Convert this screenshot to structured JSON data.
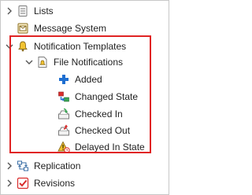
{
  "tree": {
    "lists": {
      "label": "Lists"
    },
    "message_system": {
      "label": "Message System"
    },
    "notification_templates": {
      "label": "Notification Templates",
      "file_notifications": {
        "label": "File Notifications",
        "items": [
          {
            "label": "Added"
          },
          {
            "label": "Changed State"
          },
          {
            "label": "Checked In"
          },
          {
            "label": "Checked Out"
          },
          {
            "label": "Delayed In State"
          }
        ]
      }
    },
    "replication": {
      "label": "Replication"
    },
    "revisions": {
      "label": "Revisions"
    }
  },
  "colors": {
    "highlight_border": "#e02424",
    "red_accent": "#d92c2c",
    "blue_accent": "#1f6fd1",
    "yellow_accent": "#f2c331",
    "green_accent": "#3aa655"
  }
}
